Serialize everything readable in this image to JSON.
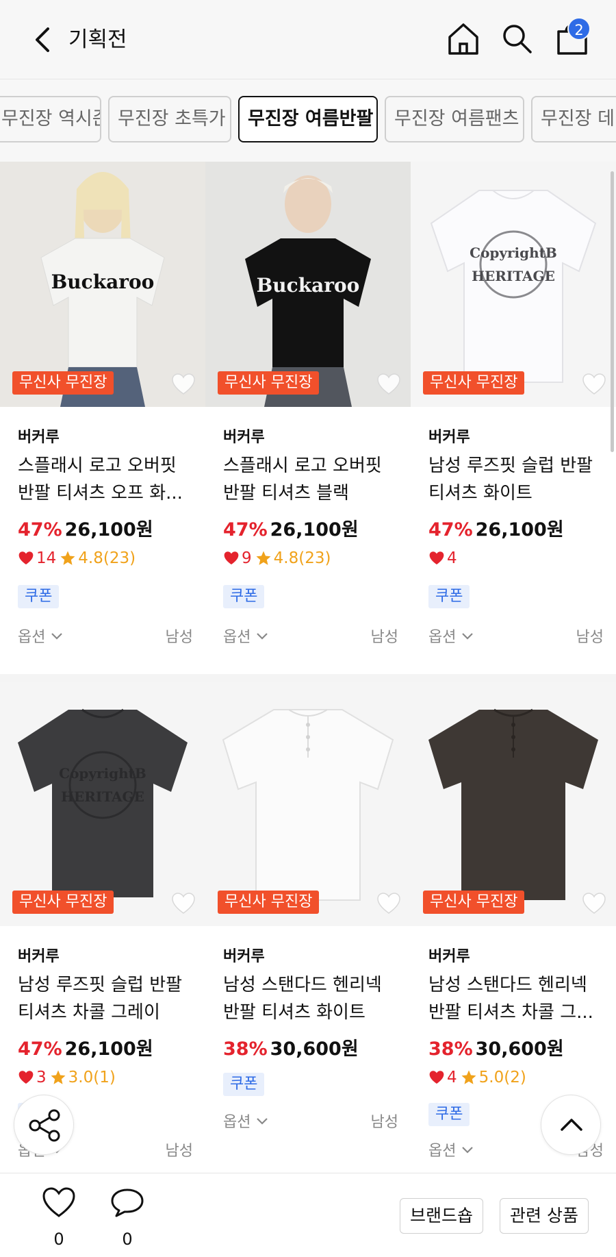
{
  "header": {
    "title": "기획전",
    "cart_count": "2",
    "icons": [
      "back-icon",
      "home-icon",
      "search-icon",
      "cart-icon"
    ]
  },
  "chips": [
    {
      "label": "무진장 역시즌",
      "active": false
    },
    {
      "label": "무진장 초특가",
      "active": false
    },
    {
      "label": "무진장 여름반팔",
      "active": true
    },
    {
      "label": "무진장 여름팬츠",
      "active": false
    },
    {
      "label": "무진장 데님",
      "active": false
    }
  ],
  "products": [
    {
      "tag": "무신사 무진장",
      "brand": "버커루",
      "name": "스플래시 로고 오버핏 반팔 티셔츠 오프 화...",
      "discount": "47%",
      "price": "26,100원",
      "likes": "14",
      "rating": "4.8(23)",
      "coupon": "쿠폰",
      "option": "옵션",
      "gender": "남성",
      "shirt_color": "#f4f4f2"
    },
    {
      "tag": "무신사 무진장",
      "brand": "버커루",
      "name": "스플래시 로고 오버핏 반팔 티셔츠 블랙",
      "discount": "47%",
      "price": "26,100원",
      "likes": "9",
      "rating": "4.8(23)",
      "coupon": "쿠폰",
      "option": "옵션",
      "gender": "남성",
      "shirt_color": "#121212"
    },
    {
      "tag": "무신사 무진장",
      "brand": "버커루",
      "name": "남성 루즈핏 슬럽 반팔 티셔츠 화이트",
      "discount": "47%",
      "price": "26,100원",
      "likes": "4",
      "rating": "",
      "coupon": "쿠폰",
      "option": "옵션",
      "gender": "남성",
      "shirt_color": "#f8f8fa"
    },
    {
      "tag": "무신사 무진장",
      "brand": "버커루",
      "name": "남성 루즈핏 슬럽 반팔 티셔츠 차콜 그레이",
      "discount": "47%",
      "price": "26,100원",
      "likes": "3",
      "rating": "3.0(1)",
      "coupon": "쿠폰",
      "option": "옵션",
      "gender": "남성",
      "shirt_color": "#3c3c3e"
    },
    {
      "tag": "무신사 무진장",
      "brand": "버커루",
      "name": "남성 스탠다드 헨리넥 반팔 티셔츠 화이트",
      "discount": "38%",
      "price": "30,600원",
      "likes": "",
      "rating": "",
      "coupon": "쿠폰",
      "option": "옵션",
      "gender": "남성",
      "shirt_color": "#f4f4f4"
    },
    {
      "tag": "무신사 무진장",
      "brand": "버커루",
      "name": "남성 스탠다드 헨리넥 반팔 티셔츠 차콜 그...",
      "discount": "38%",
      "price": "30,600원",
      "likes": "4",
      "rating": "5.0(2)",
      "coupon": "쿠폰",
      "option": "옵션",
      "gender": "남성",
      "shirt_color": "#3e3834"
    }
  ],
  "bottom": {
    "like_count": "0",
    "comment_count": "0",
    "brand_shop_label": "브랜드숍",
    "related_label": "관련 상품"
  },
  "colors": {
    "accent_tag": "#f1502b",
    "discount_red": "#e4232d",
    "star": "#f0a21b",
    "badge_blue": "#2e6be6"
  }
}
